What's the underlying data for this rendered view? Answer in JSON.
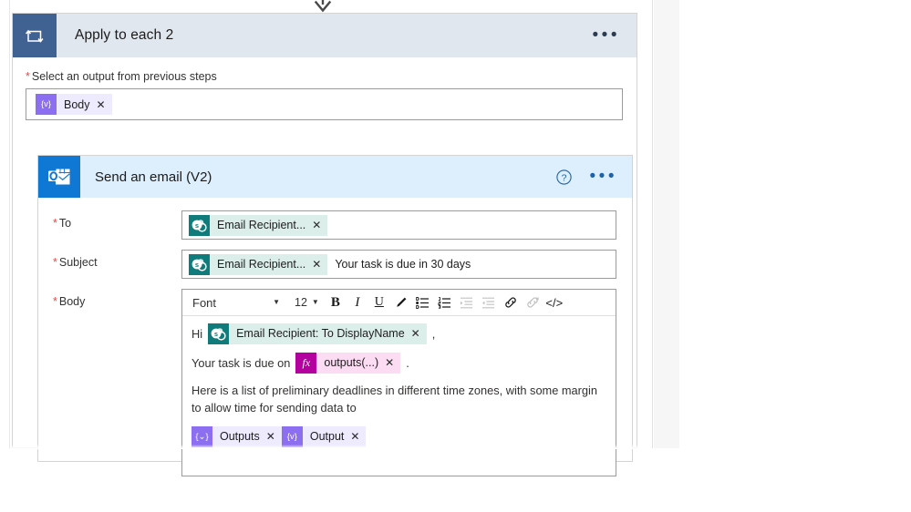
{
  "canvas": {
    "connector_icon": "down-arrow-icon"
  },
  "loop_card": {
    "icon": "apply-to-each-loop-icon",
    "title": "Apply to each 2",
    "overflow_label": "•••",
    "select_field": {
      "required_marker": "*",
      "label": "Select an output from previous steps",
      "token": {
        "icon": "variable-token-icon",
        "icon_glyph": "{v}",
        "label": "Body",
        "remove_label": "✕"
      }
    }
  },
  "email_card": {
    "icon": "outlook-icon",
    "title": "Send an email (V2)",
    "help_label": "?",
    "overflow_label": "•••",
    "fields": {
      "to": {
        "required_marker": "*",
        "label": "To",
        "token": {
          "icon": "sharepoint-token-icon",
          "label": "Email Recipient...",
          "remove_label": "✕"
        }
      },
      "subject": {
        "required_marker": "*",
        "label": "Subject",
        "token": {
          "icon": "sharepoint-token-icon",
          "label": "Email Recipient...",
          "remove_label": "✕"
        },
        "text": "Your task is due in 30 days"
      },
      "body": {
        "required_marker": "*",
        "label": "Body"
      }
    }
  },
  "editor": {
    "toolbar": {
      "font_name": "Font",
      "font_caret": "▼",
      "font_size": "12",
      "size_caret": "▼",
      "bold_label": "B",
      "italic_label": "I",
      "underline_label": "U",
      "highlight_icon": "pen-highlight-icon",
      "bullet_list_icon": "bulleted-list-icon",
      "numbered_list_icon": "numbered-list-icon",
      "indent_icon": "increase-indent-icon",
      "outdent_icon": "decrease-indent-icon",
      "link_icon": "insert-link-icon",
      "unlink_icon": "remove-link-icon",
      "code_label": "</>"
    },
    "content": {
      "line1_lead": "Hi",
      "line1_token": {
        "icon": "sharepoint-token-icon",
        "label": "Email Recipient: To DisplayName",
        "remove_label": "✕"
      },
      "line1_trail": ",",
      "line2_lead": "Your task is due on",
      "line2_token": {
        "icon": "expression-token-icon",
        "icon_glyph": "fx",
        "label": "outputs(...)",
        "remove_label": "✕"
      },
      "line2_trail": ".",
      "paragraph": "Here is a list of preliminary deadlines in different time zones, with some margin to allow time for sending data to",
      "line4_tokens": [
        {
          "icon": "variable-token-icon",
          "icon_glyph": "{⌄}",
          "label": "Outputs",
          "remove_label": "✕"
        },
        {
          "icon": "variable-token-icon",
          "icon_glyph": "{v}",
          "label": "Output",
          "remove_label": "✕"
        }
      ]
    }
  },
  "colors": {
    "loop_header_bg": "#e1e7ef",
    "loop_icon_bg": "#3f6292",
    "email_header_bg": "#ddeefc",
    "email_icon_bg": "#0f78d4",
    "token_variable": "#8c6ff0",
    "token_sharepoint": "#0f7b7b",
    "token_expression": "#b4009e",
    "required_star": "#e04b4b"
  }
}
